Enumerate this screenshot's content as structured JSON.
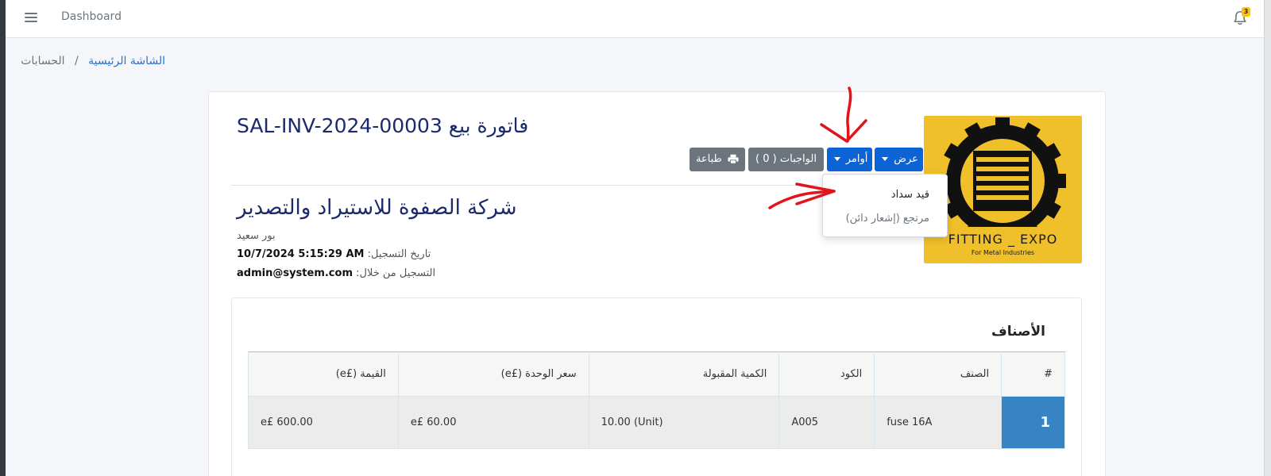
{
  "navbar": {
    "menu_icon": "hamburger-icon",
    "link_label": "Dashboard",
    "notification_icon": "bell-icon",
    "notification_count": "3"
  },
  "breadcrumb": {
    "home_label": "الشاشة الرئيسية",
    "separator": "/",
    "current_label": "الحسابات"
  },
  "invoice": {
    "title": "فاتورة بيع SAL-INV-2024-00003"
  },
  "logo": {
    "brand_text": "FITTING _ EXPO",
    "tagline": "For Metal Industries",
    "background_color": "#f0c02a"
  },
  "toolbar": {
    "show_label": "عرض",
    "orders_label": "أوامر",
    "tasks_label": "الواجبات ( 0 )",
    "print_label": "طباعة",
    "print_icon": "printer-icon",
    "primary_color": "#0b63d6",
    "secondary_color": "#6c757d"
  },
  "orders_menu": {
    "items": [
      {
        "label": "قيد سداد"
      },
      {
        "label": "مرتجع (إشعار دائن)"
      }
    ]
  },
  "company": {
    "name": "شركة الصفوة للاستيراد والتصدير",
    "city": "بور سعيد",
    "reg_date_label": "تاريخ التسجيل:",
    "reg_date_value": "10/7/2024 5:15:29 AM",
    "reg_by_label": "التسجيل من خلال:",
    "reg_by_value": "admin@system.com"
  },
  "items": {
    "title": "الأصناف",
    "columns": [
      "#",
      "الصنف",
      "الكود",
      "الكمية المقبولة",
      "سعر الوحدة (£e)",
      "القيمة (£e)"
    ],
    "rows": [
      {
        "num": "1",
        "item": "fuse 16A",
        "code": "A005",
        "qty": "10.00 (Unit)",
        "unit_price": "e£ 60.00",
        "value": "e£ 600.00"
      }
    ]
  }
}
